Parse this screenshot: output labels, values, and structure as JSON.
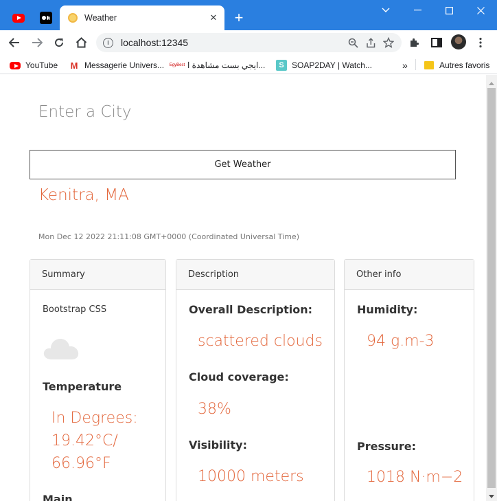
{
  "browser": {
    "pinned_tabs": [
      "youtube-icon",
      "medium-icon"
    ],
    "active_tab": {
      "title": "Weather",
      "icon": "sun-icon"
    },
    "url": "localhost:12345",
    "bookmarks": [
      {
        "label": "YouTube",
        "icon": "youtube-icon"
      },
      {
        "label": "Messagerie Univers...",
        "icon": "gmail-icon"
      },
      {
        "label": "ايجي بست مشاهدة ا...",
        "icon": "egybest-icon"
      },
      {
        "label": "SOAP2DAY | Watch...",
        "icon": "s-icon"
      }
    ],
    "bookmarks_overflow": "»",
    "other_bookmarks": "Autres favoris"
  },
  "form": {
    "city_placeholder": "Enter a City",
    "submit_label": "Get Weather"
  },
  "result": {
    "city": "Kenitra, MA",
    "timestamp": "Mon Dec 12 2022 21:11:08 GMT+0000 (Coordinated Universal Time)"
  },
  "cards": {
    "summary": {
      "header": "Summary",
      "subtitle": "Bootstrap CSS",
      "icon": "cloud-icon",
      "temperature_label": "Temperature",
      "temperature_value": "In Degrees: 19.42°C/ 66.96°F",
      "next_label": "Main"
    },
    "description": {
      "header": "Description",
      "overall_label": "Overall Description:",
      "overall_value": "scattered clouds",
      "cloud_label": "Cloud coverage:",
      "cloud_value": "38%",
      "visibility_label": "Visibility:",
      "visibility_value": "10000 meters"
    },
    "other": {
      "header": "Other info",
      "humidity_label": "Humidity:",
      "humidity_value": "94 g.m-3",
      "pressure_label": "Pressure:",
      "pressure_value": "1018 N·m−2"
    }
  },
  "colors": {
    "titlebar": "#2a7fe0",
    "accent_text": "#e3673c"
  }
}
